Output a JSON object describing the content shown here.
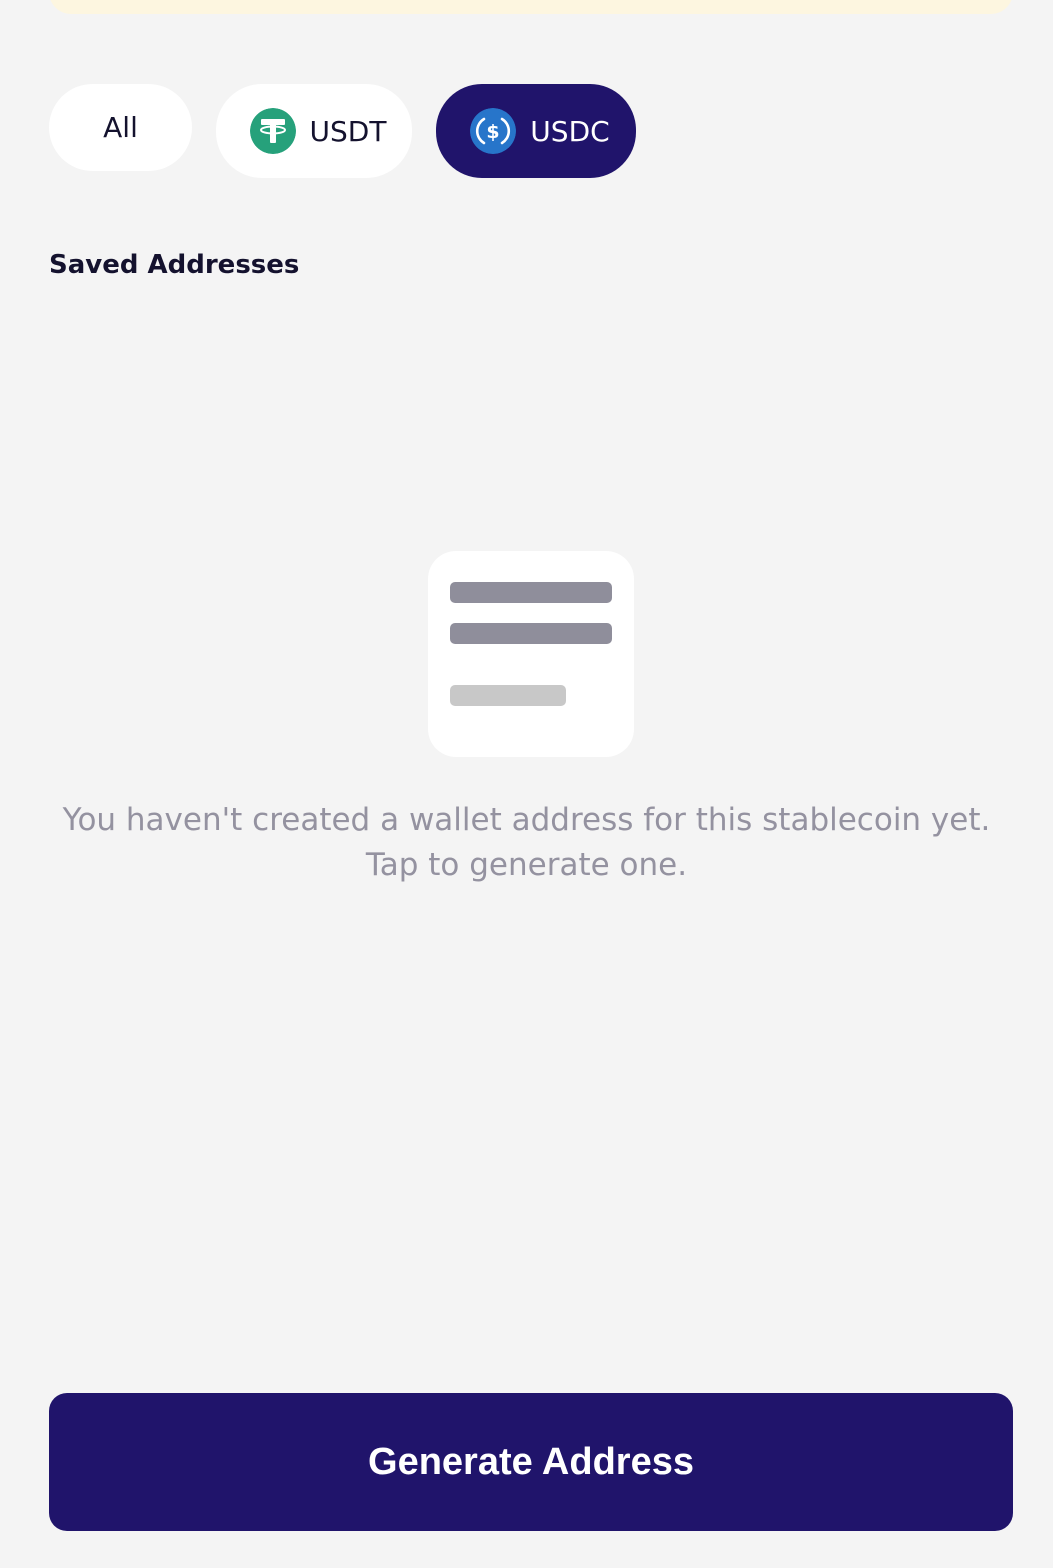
{
  "filters": {
    "all_label": "All",
    "usdt_label": "USDT",
    "usdc_label": "USDC",
    "selected": "USDC",
    "usdt_icon": "tether-icon",
    "usdc_icon": "usd-coin-icon"
  },
  "saved_addresses": {
    "title": "Saved Addresses",
    "empty_line_1": "You haven't created a wallet address for this stablecoin yet.",
    "empty_line_2": "Tap to generate one.",
    "empty_icon": "document-placeholder-icon"
  },
  "actions": {
    "generate_label": "Generate Address"
  },
  "colors": {
    "primary": "#20146b",
    "background": "#f4f4f4",
    "usdt_green": "#26a17b",
    "usdc_blue": "#2775ca",
    "muted_text": "#9492a0"
  }
}
